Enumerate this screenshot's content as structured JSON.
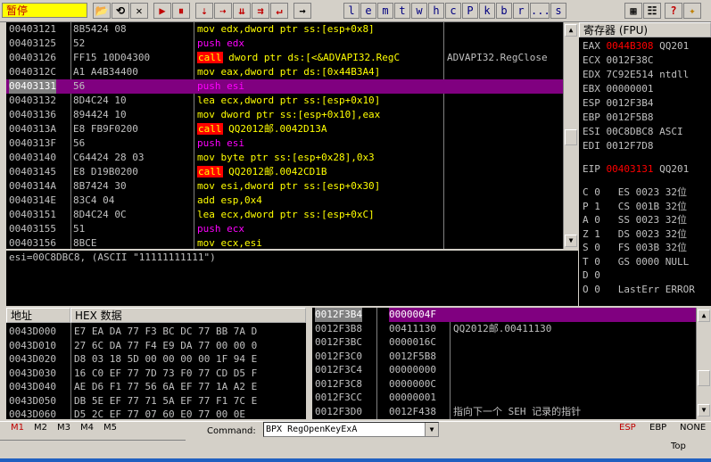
{
  "toolbar": {
    "status": "暂停",
    "buttons": [
      {
        "id": "open",
        "glyph": "📂"
      },
      {
        "id": "restart",
        "glyph": "⟲"
      },
      {
        "id": "close",
        "glyph": "✕"
      },
      {
        "id": "run",
        "glyph": "▶"
      },
      {
        "id": "pause",
        "glyph": "⏸"
      },
      {
        "id": "step-into",
        "glyph": "⇣"
      },
      {
        "id": "step-over",
        "glyph": "⇢"
      },
      {
        "id": "trace-into",
        "glyph": "⇊"
      },
      {
        "id": "trace-over",
        "glyph": "⇉"
      },
      {
        "id": "execute-till-return",
        "glyph": "↵"
      },
      {
        "id": "go-to",
        "glyph": "→"
      }
    ],
    "letters": [
      "l",
      "e",
      "m",
      "t",
      "w",
      "h",
      "c",
      "P",
      "k",
      "b",
      "r",
      "...",
      "s"
    ]
  },
  "disasm": {
    "rows": [
      {
        "addr": "00403121",
        "hex": "8B5424 08",
        "op": "mov",
        "args": "edx,dword ptr ss:[esp+0x8]",
        "cmt": ""
      },
      {
        "addr": "00403125",
        "hex": "52",
        "op": "push",
        "args": "edx",
        "cmt": ""
      },
      {
        "addr": "00403126",
        "hex": "FF15 10D04300",
        "op": "call",
        "args": "dword ptr ds:[<&ADVAPI32.RegC",
        "cmt": "ADVAPI32.RegClose"
      },
      {
        "addr": "0040312C",
        "hex": "A1 A4B34400",
        "op": "mov",
        "args": "eax,dword ptr ds:[0x44B3A4]",
        "cmt": ""
      },
      {
        "addr": "00403131",
        "hex": "56",
        "op": "push",
        "args": "esi",
        "cmt": "",
        "selected": true
      },
      {
        "addr": "00403132",
        "hex": "8D4C24 10",
        "op": "lea",
        "args": "ecx,dword ptr ss:[esp+0x10]",
        "cmt": ""
      },
      {
        "addr": "00403136",
        "hex": "894424 10",
        "op": "mov",
        "args": "dword ptr ss:[esp+0x10],eax",
        "cmt": ""
      },
      {
        "addr": "0040313A",
        "hex": "E8 FB9F0200",
        "op": "call",
        "args": "QQ2012邮.0042D13A",
        "cmt": ""
      },
      {
        "addr": "0040313F",
        "hex": "56",
        "op": "push",
        "args": "esi",
        "cmt": ""
      },
      {
        "addr": "00403140",
        "hex": "C64424 28 03",
        "op": "mov",
        "args": "byte ptr ss:[esp+0x28],0x3",
        "cmt": ""
      },
      {
        "addr": "00403145",
        "hex": "E8 D19B0200",
        "op": "call",
        "args": "QQ2012邮.0042CD1B",
        "cmt": ""
      },
      {
        "addr": "0040314A",
        "hex": "8B7424 30",
        "op": "mov",
        "args": "esi,dword ptr ss:[esp+0x30]",
        "cmt": ""
      },
      {
        "addr": "0040314E",
        "hex": "83C4 04",
        "op": "add",
        "args": "esp,0x4",
        "cmt": ""
      },
      {
        "addr": "00403151",
        "hex": "8D4C24 0C",
        "op": "lea",
        "args": "ecx,dword ptr ss:[esp+0xC]",
        "cmt": ""
      },
      {
        "addr": "00403155",
        "hex": "51",
        "op": "push",
        "args": "ecx",
        "cmt": ""
      },
      {
        "addr": "00403156",
        "hex": "8BCE",
        "op": "mov",
        "args": "ecx,esi",
        "cmt": ""
      }
    ]
  },
  "info_line": "esi=00C8DBC8, (ASCII \"11111111111\")",
  "registers": {
    "title": "寄存器 (FPU)",
    "rows": [
      {
        "name": "EAX",
        "value": "0044B308",
        "extra": "QQ201",
        "red": true
      },
      {
        "name": "ECX",
        "value": "0012F38C",
        "extra": ""
      },
      {
        "name": "EDX",
        "value": "7C92E514",
        "extra": "ntdll"
      },
      {
        "name": "EBX",
        "value": "00000001",
        "extra": ""
      },
      {
        "name": "ESP",
        "value": "0012F3B4",
        "extra": ""
      },
      {
        "name": "EBP",
        "value": "0012F5B8",
        "extra": ""
      },
      {
        "name": "ESI",
        "value": "00C8DBC8",
        "extra": "ASCI"
      },
      {
        "name": "EDI",
        "value": "0012F7D8",
        "extra": ""
      }
    ],
    "eip": {
      "name": "EIP",
      "value": "00403131",
      "extra": "QQ201"
    },
    "flags": [
      {
        "f": "C",
        "v": "0",
        "seg": "ES",
        "sv": "0023",
        "bits": "32位"
      },
      {
        "f": "P",
        "v": "1",
        "seg": "CS",
        "sv": "001B",
        "bits": "32位"
      },
      {
        "f": "A",
        "v": "0",
        "seg": "SS",
        "sv": "0023",
        "bits": "32位"
      },
      {
        "f": "Z",
        "v": "1",
        "seg": "DS",
        "sv": "0023",
        "bits": "32位"
      },
      {
        "f": "S",
        "v": "0",
        "seg": "FS",
        "sv": "003B",
        "bits": "32位"
      },
      {
        "f": "T",
        "v": "0",
        "seg": "GS",
        "sv": "0000",
        "bits": "NULL"
      },
      {
        "f": "D",
        "v": "0",
        "seg": "",
        "sv": "",
        "bits": ""
      },
      {
        "f": "O",
        "v": "0",
        "seg": "LastErr",
        "sv": "",
        "bits": "ERROR"
      }
    ]
  },
  "dump": {
    "addr_header": "地址",
    "hex_header": "HEX 数据",
    "rows": [
      {
        "addr": "0043D000",
        "hex": "E7 EA DA 77 F3 BC DC 77 BB 7A D"
      },
      {
        "addr": "0043D010",
        "hex": "27 6C DA 77 F4 E9 DA 77 00 00 0"
      },
      {
        "addr": "0043D020",
        "hex": "D8 03 18 5D 00 00 00 00 1F 94 E"
      },
      {
        "addr": "0043D030",
        "hex": "16 C0 EF 77 7D 73 F0 77 CD D5 F"
      },
      {
        "addr": "0043D040",
        "hex": "AE D6 F1 77 56 6A EF 77 1A A2 E"
      },
      {
        "addr": "0043D050",
        "hex": "DB 5E EF 77 71 5A EF 77 F1 7C E"
      },
      {
        "addr": "0043D060",
        "hex": "D5 2C EF 77 07 60 E0 77 00 0E"
      }
    ]
  },
  "stack": {
    "rows": [
      {
        "addr": "0012F3B4",
        "val": "0000004F",
        "cmt": "",
        "selected": true
      },
      {
        "addr": "0012F3B8",
        "val": "00411130",
        "cmt": "QQ2012邮.00411130"
      },
      {
        "addr": "0012F3BC",
        "val": "0000016C",
        "cmt": ""
      },
      {
        "addr": "0012F3C0",
        "val": "0012F5B8",
        "cmt": ""
      },
      {
        "addr": "0012F3C4",
        "val": "00000000",
        "cmt": ""
      },
      {
        "addr": "0012F3C8",
        "val": "0000000C",
        "cmt": ""
      },
      {
        "addr": "0012F3CC",
        "val": "00000001",
        "cmt": ""
      },
      {
        "addr": "0012F3D0",
        "val": "0012F438",
        "cmt": "指向下一个 SEH 记录的指针"
      }
    ]
  },
  "bottom": {
    "mtabs": [
      "M1",
      "M2",
      "M3",
      "M4",
      "M5"
    ],
    "command_label": "Command:",
    "command_value": "BPX RegOpenKeyExA",
    "reg_tabs": [
      "ESP",
      "EBP",
      "NONE"
    ],
    "top_label": "Top"
  },
  "colors": {
    "selection": "#800080",
    "call_bg": "#ff0000",
    "mnemonic": "#ffff00",
    "push": "#ff00ff",
    "status_bg": "#ffff00"
  }
}
